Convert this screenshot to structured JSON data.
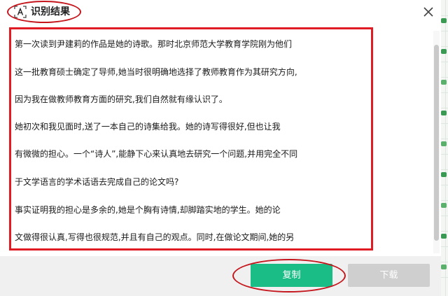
{
  "dialog": {
    "title": "识别结果",
    "title_icon": "text-recognition-icon",
    "close_icon": "close-icon"
  },
  "result_text": {
    "lines": [
      "第一次读到尹建莉的作品是她的诗歌。那时北京师范大学教育学院刚为他们",
      "这一批教育硕士确定了导师,她当时很明确地选择了教师教育作为其研究方向,",
      "因为我在做教师教育方面的研究,我们自然就有缘认识了。",
      "她初次和我见面时,送了一本自己的诗集给我。她的诗写得很好,但也让我",
      "有微微的担心。一个“诗人”,能静下心来认真地去研究一个问题,并用完全不同",
      "于文学语言的学术话语去完成自己的论文吗?",
      "事实证明我的担心是多余的,她是个胸有诗情,却脚踏实地的学生。她的论",
      "文做得很认真,写得也很规范,并且有自己的观点。同时,在做论文期间,她的另"
    ]
  },
  "footer": {
    "copy_label": "复制",
    "download_label": "下载"
  },
  "colors": {
    "accent_green": "#1bbd87",
    "disabled_gray": "#cfcfcf",
    "annotation_red": "#e11b24"
  }
}
